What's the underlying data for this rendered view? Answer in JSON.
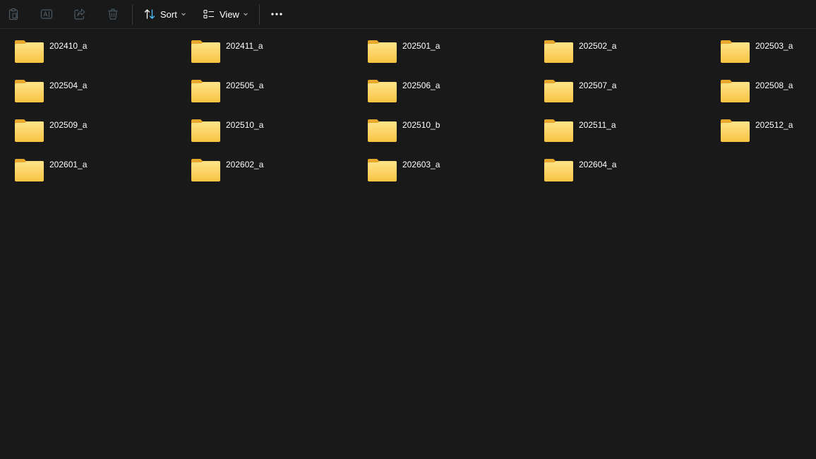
{
  "toolbar": {
    "buttons": [
      {
        "name": "paste-button",
        "icon": "clipboard-icon"
      },
      {
        "name": "rename-button",
        "icon": "rename-icon"
      },
      {
        "name": "share-button",
        "icon": "share-icon"
      },
      {
        "name": "delete-button",
        "icon": "trash-icon"
      }
    ],
    "sort_label": "Sort",
    "view_label": "View",
    "more_label": "•••",
    "colors": {
      "disabled_icon": "#4a5a66",
      "accent": "#4cc2ff",
      "text": "#ffffff"
    }
  },
  "folders": [
    {
      "name": "202410_a"
    },
    {
      "name": "202411_a"
    },
    {
      "name": "202501_a"
    },
    {
      "name": "202502_a"
    },
    {
      "name": "202503_a"
    },
    {
      "name": "202504_a"
    },
    {
      "name": "202505_a"
    },
    {
      "name": "202506_a"
    },
    {
      "name": "202507_a"
    },
    {
      "name": "202508_a"
    },
    {
      "name": "202509_a"
    },
    {
      "name": "202510_a"
    },
    {
      "name": "202510_b"
    },
    {
      "name": "202511_a"
    },
    {
      "name": "202512_a"
    },
    {
      "name": "202601_a"
    },
    {
      "name": "202602_a"
    },
    {
      "name": "202603_a"
    },
    {
      "name": "202604_a"
    }
  ],
  "folder_colors": {
    "back": "#e8a82b",
    "front_top": "#ffe48a",
    "front_bottom": "#f8c443"
  }
}
